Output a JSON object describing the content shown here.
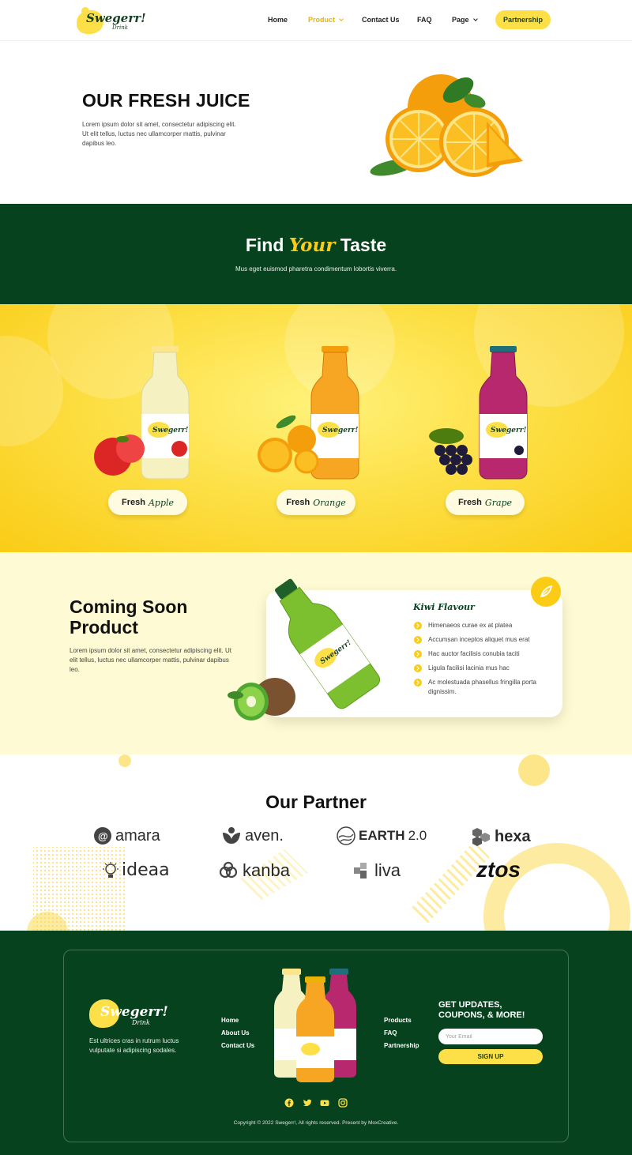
{
  "brand": {
    "name": "Swegerr!",
    "sub": "Drink"
  },
  "nav": {
    "items": [
      {
        "label": "Home"
      },
      {
        "label": "Product"
      },
      {
        "label": "Contact Us"
      },
      {
        "label": "FAQ"
      },
      {
        "label": "Page"
      }
    ],
    "cta": "Partnership"
  },
  "hero": {
    "title": "OUR FRESH JUICE",
    "text": "Lorem ipsum dolor sit amet, consectetur adipiscing elit. Ut elit tellus, luctus nec ullamcorper mattis, pulvinar dapibus leo."
  },
  "find": {
    "title_pre": "Find",
    "title_hl": "Your",
    "title_post": "Taste",
    "subtitle": "Mus eget euismod pharetra condimentum lobortis viverra."
  },
  "products": [
    {
      "prefix": "Fresh",
      "flavor": "Apple"
    },
    {
      "prefix": "Fresh",
      "flavor": "Orange"
    },
    {
      "prefix": "Fresh",
      "flavor": "Grape"
    }
  ],
  "coming": {
    "title": "Coming Soon Product",
    "text": "Lorem ipsum dolor sit amet, consectetur adipiscing elit. Ut elit tellus, luctus nec ullamcorper mattis, pulvinar dapibus leo.",
    "card_title": "Kiwi Flavour",
    "features": [
      "Himenaeos curae ex at platea",
      "Accumsan inceptos aliquet mus erat",
      "Hac auctor facilisis conubia taciti",
      "Ligula facilisi lacinia mus hac",
      "Ac molestuada phasellus fringilla porta dignissim."
    ]
  },
  "partners": {
    "title": "Our Partner",
    "logos": [
      "amara",
      "aven.",
      "EARTH",
      "2.0",
      "hexa",
      "ideaa",
      "kanba",
      "liva",
      "ztos"
    ]
  },
  "footer": {
    "desc": "Est ultrices cras in rutrum luctus vulputate si adipiscing sodales.",
    "links_left": [
      "Home",
      "About Us",
      "Contact Us"
    ],
    "links_right": [
      "Products",
      "FAQ",
      "Partnership"
    ],
    "newsletter_title": "GET UPDATES, COUPONS, & MORE!",
    "email_placeholder": "Your Email",
    "signup": "SIGN UP",
    "copyright": "Copyright © 2022 Swegerr!, All rights reserved. Present by MoxCreative."
  },
  "colors": {
    "dark_green": "#07421f",
    "yellow": "#fde047",
    "accent_yellow": "#facc15",
    "cream": "#fefad3"
  },
  "icons": [
    "facebook-icon",
    "twitter-icon",
    "youtube-icon",
    "instagram-icon",
    "leaf-icon",
    "arrow-circle-icon"
  ]
}
